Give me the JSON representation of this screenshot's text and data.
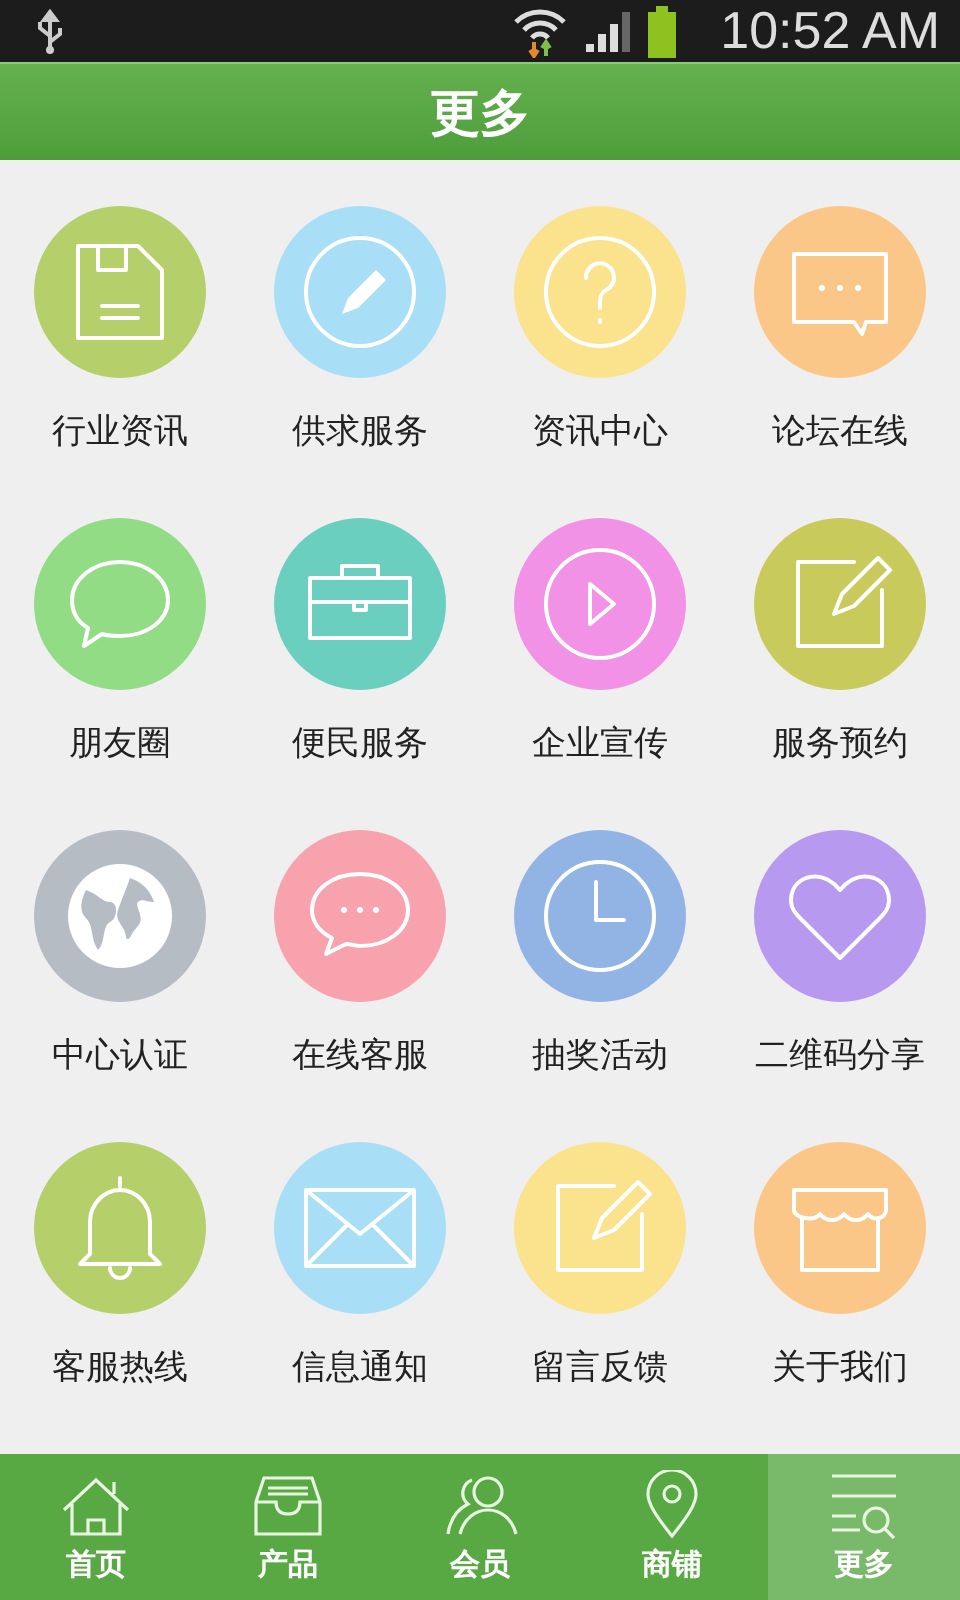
{
  "status_bar": {
    "time": "10:52 AM"
  },
  "header": {
    "title": "更多"
  },
  "grid": [
    {
      "label": "行业资讯",
      "kind": "floppy",
      "color": "#b5cf6a"
    },
    {
      "label": "供求服务",
      "kind": "pencil",
      "color": "#a9def7"
    },
    {
      "label": "资讯中心",
      "kind": "question",
      "color": "#fbe38e"
    },
    {
      "label": "论坛在线",
      "kind": "chat",
      "color": "#fbc788"
    },
    {
      "label": "朋友圈",
      "kind": "bubble",
      "color": "#92dc86"
    },
    {
      "label": "便民服务",
      "kind": "briefcase",
      "color": "#6bcfbf"
    },
    {
      "label": "企业宣传",
      "kind": "play",
      "color": "#f192e6"
    },
    {
      "label": "服务预约",
      "kind": "note",
      "color": "#c8cb5c"
    },
    {
      "label": "中心认证",
      "kind": "globe",
      "color": "#b6bcc4"
    },
    {
      "label": "在线客服",
      "kind": "chat-round",
      "color": "#f8a2ad"
    },
    {
      "label": "抽奖活动",
      "kind": "clock",
      "color": "#92b4e4"
    },
    {
      "label": "二维码分享",
      "kind": "heart",
      "color": "#b79af0"
    },
    {
      "label": "客服热线",
      "kind": "bell",
      "color": "#b5cf6a"
    },
    {
      "label": "信息通知",
      "kind": "mail",
      "color": "#a9def7"
    },
    {
      "label": "留言反馈",
      "kind": "note",
      "color": "#fbe38e"
    },
    {
      "label": "关于我们",
      "kind": "shop",
      "color": "#fbc788"
    }
  ],
  "nav": [
    {
      "label": "首页",
      "kind": "home",
      "selected": false
    },
    {
      "label": "产品",
      "kind": "tray",
      "selected": false
    },
    {
      "label": "会员",
      "kind": "people",
      "selected": false
    },
    {
      "label": "商铺",
      "kind": "pin",
      "selected": false
    },
    {
      "label": "更多",
      "kind": "menu",
      "selected": true
    }
  ]
}
